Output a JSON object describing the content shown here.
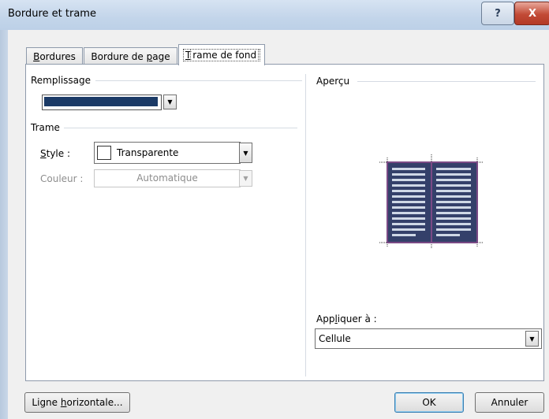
{
  "window": {
    "title": "Bordure et trame",
    "help_label": "?",
    "close_label": "X"
  },
  "tabs": [
    {
      "label_pre": "",
      "label_ul": "B",
      "label_post": "ordures"
    },
    {
      "label_pre": "Bordure de ",
      "label_ul": "p",
      "label_post": "age"
    },
    {
      "label_pre": "",
      "label_ul": "T",
      "label_post": "rame de fond"
    }
  ],
  "remplissage": {
    "label": "Remplissage",
    "color": "#1b3a66"
  },
  "trame": {
    "label": "Trame",
    "style_label_ul": "S",
    "style_label_post": "tyle :",
    "style_value": "Transparente",
    "couleur_label": "Couleur :",
    "couleur_value": "Automatique"
  },
  "apercu": {
    "label": "Aperçu"
  },
  "appliquer": {
    "label_pre": "App",
    "label_ul": "l",
    "label_post": "iquer à :",
    "value": "Cellule"
  },
  "buttons": {
    "ligne_pre": "Ligne ",
    "ligne_ul": "h",
    "ligne_post": "orizontale...",
    "ok": "OK",
    "annuler": "Annuler"
  }
}
